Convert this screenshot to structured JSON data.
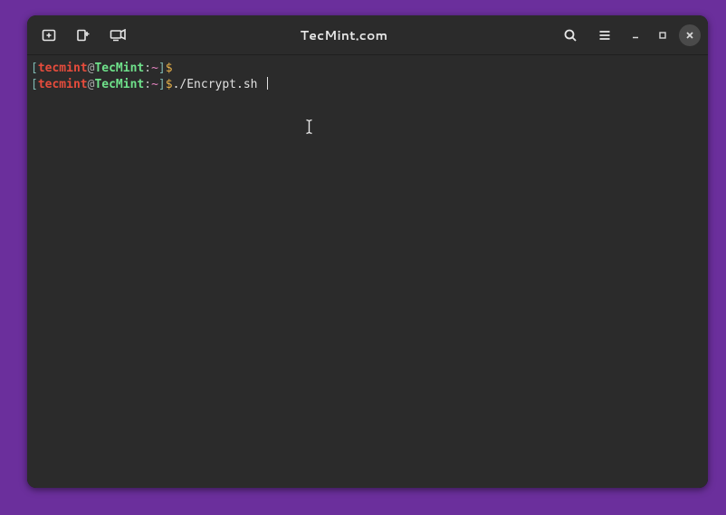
{
  "window": {
    "title": "TecMint.com"
  },
  "prompt": {
    "open_br": "[",
    "user": "tecmint",
    "at": "@",
    "host": "TecMint",
    "colon": ":",
    "dir": "~",
    "close_br": "]",
    "dollar": "$"
  },
  "lines": {
    "l0_cmd": "",
    "l1_cmd": "./Encrypt.sh "
  },
  "icons": {
    "new_tab": "new-tab-icon",
    "new_window": "new-window-icon",
    "broadcast": "broadcast-icon",
    "search": "search-icon",
    "menu": "hamburger-menu-icon",
    "minimize": "minimize-icon",
    "maximize": "maximize-icon",
    "close": "close-icon"
  }
}
